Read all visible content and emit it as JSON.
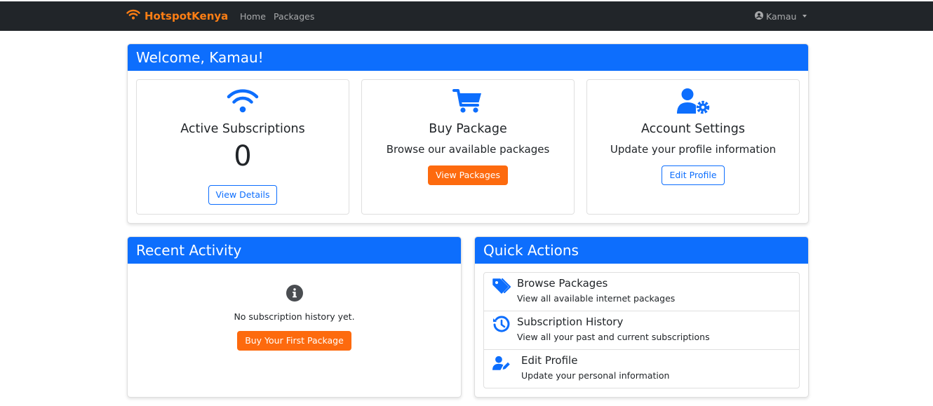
{
  "navbar": {
    "brand": "HotspotKenya",
    "links": [
      "Home",
      "Packages"
    ],
    "user": "Kamau",
    "brand_color": "#fd7e14",
    "bg_color": "#212529"
  },
  "welcome": {
    "title": "Welcome, Kamau!",
    "cards": [
      {
        "icon": "wifi-icon",
        "title": "Active Subscriptions",
        "value": "0",
        "button": "View Details"
      },
      {
        "icon": "cart-icon",
        "title": "Buy Package",
        "subtitle": "Browse our available packages",
        "button": "View Packages"
      },
      {
        "icon": "user-gear-icon",
        "title": "Account Settings",
        "subtitle": "Update your profile information",
        "button": "Edit Profile"
      }
    ]
  },
  "recent": {
    "title": "Recent Activity",
    "empty_icon": "info-circle-icon",
    "empty_text": "No subscription history yet.",
    "button": "Buy Your First Package"
  },
  "quick": {
    "title": "Quick Actions",
    "items": [
      {
        "icon": "tags-icon",
        "title": "Browse Packages",
        "desc": "View all available internet packages"
      },
      {
        "icon": "history-icon",
        "title": "Subscription History",
        "desc": "View all your past and current subscriptions"
      },
      {
        "icon": "user-edit-icon",
        "title": "Edit Profile",
        "desc": "Update your personal information"
      }
    ]
  },
  "colors": {
    "primary": "#0d6efd",
    "accent": "#fd6a0e"
  }
}
